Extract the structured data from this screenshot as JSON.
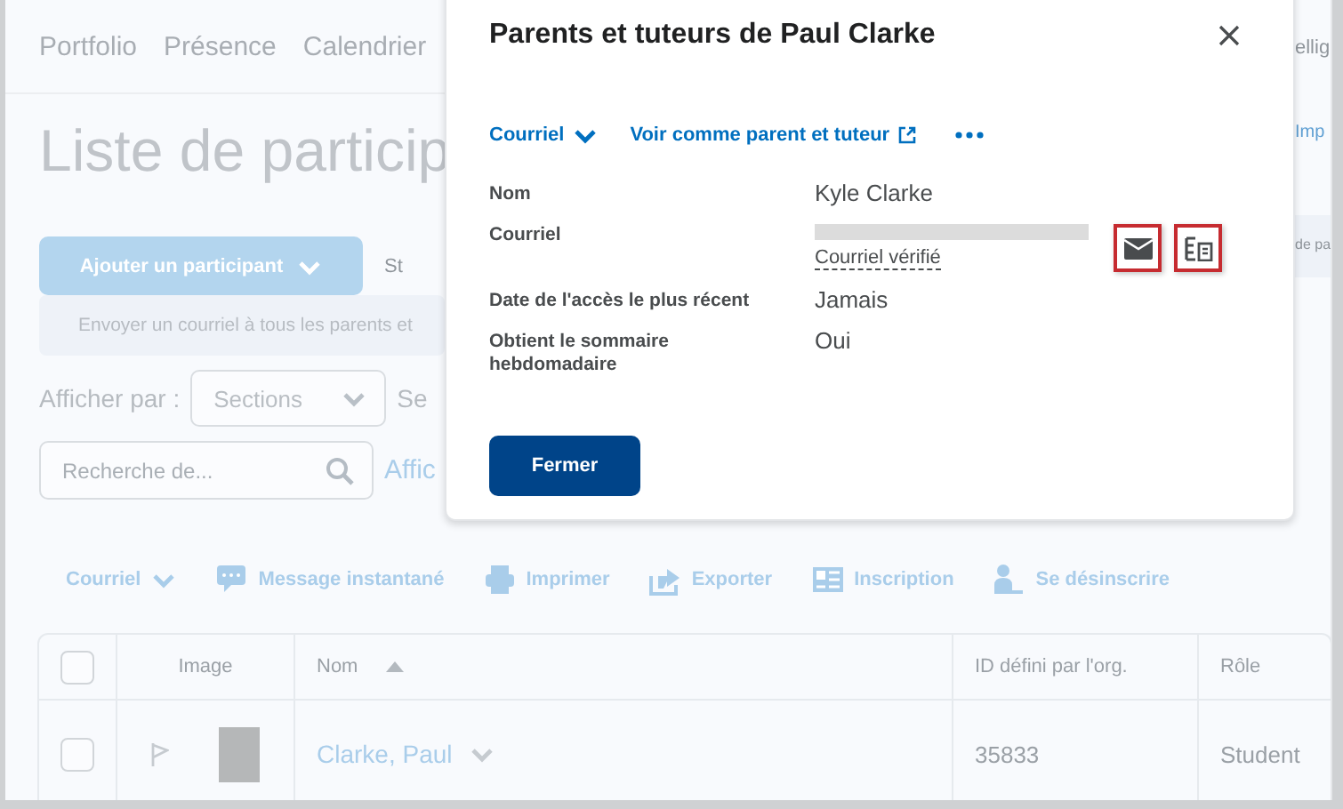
{
  "nav_tabs": [
    {
      "label": "Portfolio"
    },
    {
      "label": "Présence"
    },
    {
      "label": "Calendrier"
    }
  ],
  "nav_tab_fragment": "ellig",
  "page_title": "Liste de particip",
  "import_fragment": "Imp",
  "add_participant_button": "Ajouter un participant",
  "button_fragment": "St",
  "email_all_banner": "Envoyer un courriel à tous les parents et",
  "banner_fragment": "de pa",
  "view_by": {
    "label": "Afficher par :",
    "select_value": "Sections",
    "next_label": "Se"
  },
  "search": {
    "placeholder": "Recherche de...",
    "link": "Affic"
  },
  "toolbar": [
    {
      "label": "Courriel",
      "kind": "dropdown"
    },
    {
      "label": "Message instantané",
      "kind": "message"
    },
    {
      "label": "Imprimer",
      "kind": "print"
    },
    {
      "label": "Exporter",
      "kind": "export"
    },
    {
      "label": "Inscription",
      "kind": "enroll"
    },
    {
      "label": "Se désinscrire",
      "kind": "unenroll"
    }
  ],
  "table": {
    "select_all_checked": false,
    "columns": [
      {
        "label": "Image",
        "sorted": false
      },
      {
        "label": "Nom",
        "sorted": true
      },
      {
        "label": "ID défini par l'org.",
        "sorted": false
      },
      {
        "label": "Rôle",
        "sorted": false
      }
    ],
    "rows": [
      {
        "checked": false,
        "name": "Clarke, Paul",
        "org_id": "35833",
        "role": "Student"
      }
    ]
  },
  "dialog": {
    "title": "Parents et tuteurs de Paul Clarke",
    "actions": [
      {
        "label": "Courriel",
        "kind": "dropdown"
      },
      {
        "label": "Voir comme parent et tuteur",
        "kind": "external"
      },
      {
        "kind": "more"
      }
    ],
    "fields": [
      {
        "label": "Nom",
        "kind": "text",
        "value": "Kyle Clarke"
      },
      {
        "label": "Courriel",
        "kind": "email",
        "note": "Courriel vérifié"
      },
      {
        "label": "Date de l'accès le plus récent",
        "kind": "text",
        "value": "Jamais"
      },
      {
        "label": "Obtient le sommaire hebdomadaire",
        "kind": "text",
        "value": "Oui"
      }
    ],
    "close_button": "Fermer"
  }
}
